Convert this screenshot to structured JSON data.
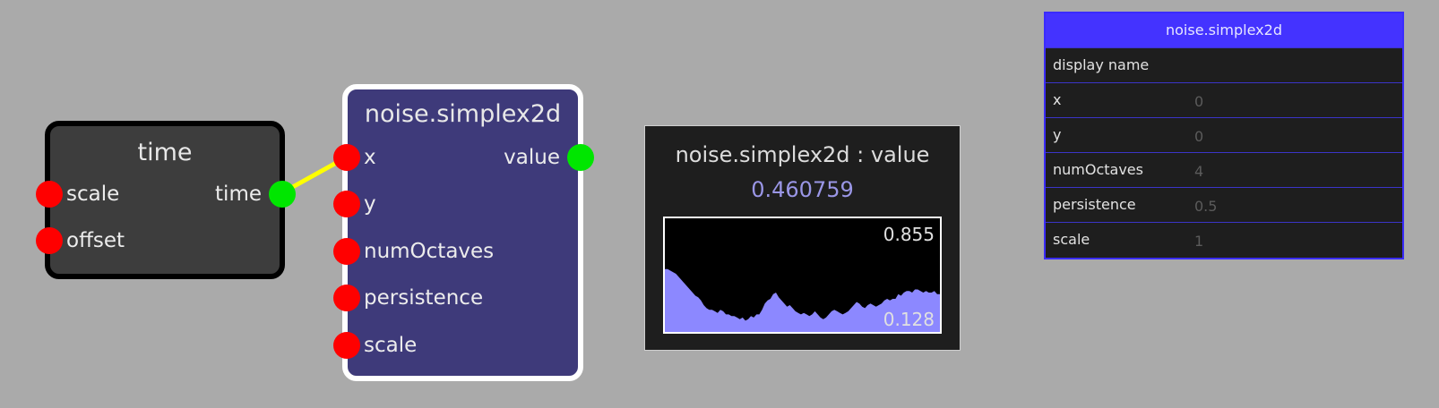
{
  "colors": {
    "canvas_bg": "#aaaaaa",
    "time_node_bg": "#3d3d3d",
    "noise_node_bg": "#3e3a7a",
    "input_port": "#ff0000",
    "output_port": "#00e600",
    "wire": "#ffff00",
    "inspector_accent": "#4433ff",
    "graph_fill": "#8c88ff"
  },
  "time_node": {
    "title": "time",
    "inputs": [
      "scale",
      "offset"
    ],
    "output": "time"
  },
  "noise_node": {
    "title": "noise.simplex2d",
    "inputs": [
      "x",
      "y",
      "numOctaves",
      "persistence",
      "scale"
    ],
    "output": "value"
  },
  "monitor": {
    "title": "noise.simplex2d : value",
    "value": "0.460759",
    "max_label": "0.855",
    "min_label": "0.128",
    "range": [
      0.128,
      0.855
    ],
    "history": [
      0.53,
      0.53,
      0.52,
      0.51,
      0.5,
      0.48,
      0.46,
      0.44,
      0.42,
      0.4,
      0.38,
      0.36,
      0.35,
      0.33,
      0.3,
      0.28,
      0.27,
      0.27,
      0.26,
      0.25,
      0.27,
      0.26,
      0.24,
      0.24,
      0.23,
      0.23,
      0.22,
      0.21,
      0.22,
      0.2,
      0.21,
      0.23,
      0.22,
      0.24,
      0.24,
      0.27,
      0.31,
      0.33,
      0.34,
      0.37,
      0.38,
      0.35,
      0.33,
      0.31,
      0.29,
      0.3,
      0.28,
      0.26,
      0.25,
      0.24,
      0.25,
      0.24,
      0.23,
      0.24,
      0.26,
      0.24,
      0.22,
      0.21,
      0.22,
      0.24,
      0.26,
      0.27,
      0.26,
      0.25,
      0.24,
      0.25,
      0.26,
      0.28,
      0.3,
      0.32,
      0.31,
      0.29,
      0.28,
      0.3,
      0.31,
      0.3,
      0.29,
      0.3,
      0.31,
      0.33,
      0.34,
      0.33,
      0.34,
      0.34,
      0.37,
      0.36,
      0.38,
      0.39,
      0.39,
      0.38,
      0.4,
      0.4,
      0.39,
      0.38,
      0.39,
      0.38,
      0.38,
      0.39,
      0.37,
      0.37
    ]
  },
  "inspector": {
    "title": "noise.simplex2d",
    "display_name_label": "display name",
    "fields": [
      {
        "label": "x",
        "value": "0"
      },
      {
        "label": "y",
        "value": "0"
      },
      {
        "label": "numOctaves",
        "value": "4"
      },
      {
        "label": "persistence",
        "value": "0.5"
      },
      {
        "label": "scale",
        "value": "1"
      }
    ]
  }
}
